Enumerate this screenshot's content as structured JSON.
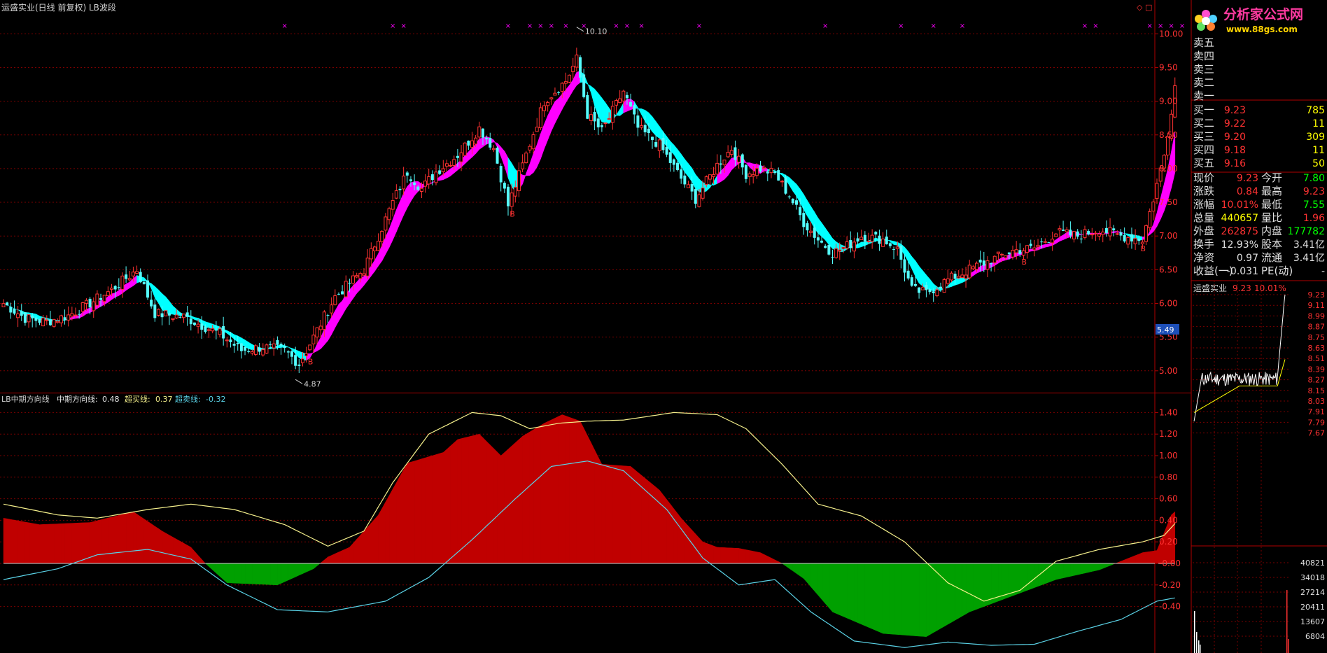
{
  "header": {
    "main_title": "运盛实业(日线 前复权) LB波段",
    "corner_icons": "◇ □",
    "price_tag": "5.49"
  },
  "indicator_header": {
    "name": "LB中期方向线",
    "mid_label": "中期方向线:",
    "mid_value": "0.48",
    "buy_label": "超买线:",
    "buy_value": "0.37",
    "sell_label": "超卖线:",
    "sell_value": "-0.32"
  },
  "logo": {
    "text": "分析家公式网",
    "url": "www.88gs.com"
  },
  "colors": {
    "up": "#ff3232",
    "down": "#54fcfc",
    "band_up": "#ff00ff",
    "band_down": "#00ffff",
    "area_pos": "#c00000",
    "area_neg": "#00a000",
    "yellow_line": "#f5f08c",
    "cyan_line": "#5ad2e6",
    "grid": "#7a0000",
    "text_yellow": "#ffff00",
    "text_green": "#00ff00"
  },
  "order_book": {
    "asks": [
      {
        "label": "卖五",
        "price": "",
        "vol": ""
      },
      {
        "label": "卖四",
        "price": "",
        "vol": ""
      },
      {
        "label": "卖三",
        "price": "",
        "vol": ""
      },
      {
        "label": "卖二",
        "price": "",
        "vol": ""
      },
      {
        "label": "卖一",
        "price": "",
        "vol": ""
      }
    ],
    "bids": [
      {
        "label": "买一",
        "price": "9.23",
        "vol": "785"
      },
      {
        "label": "买二",
        "price": "9.22",
        "vol": "11"
      },
      {
        "label": "买三",
        "price": "9.20",
        "vol": "309"
      },
      {
        "label": "买四",
        "price": "9.18",
        "vol": "11"
      },
      {
        "label": "买五",
        "price": "9.16",
        "vol": "50"
      }
    ]
  },
  "quote": [
    {
      "l1": "现价",
      "v1": "9.23",
      "c1": "r",
      "l2": "今开",
      "v2": "7.80",
      "c2": "g"
    },
    {
      "l1": "涨跌",
      "v1": "0.84",
      "c1": "r",
      "l2": "最高",
      "v2": "9.23",
      "c2": "r"
    },
    {
      "l1": "涨幅",
      "v1": "10.01%",
      "c1": "r",
      "l2": "最低",
      "v2": "7.55",
      "c2": "g"
    },
    {
      "l1": "总量",
      "v1": "440657",
      "c1": "y",
      "l2": "量比",
      "v2": "1.96",
      "c2": "r"
    },
    {
      "l1": "外盘",
      "v1": "262875",
      "c1": "r",
      "l2": "内盘",
      "v2": "177782",
      "c2": "g"
    },
    {
      "l1": "换手",
      "v1": "12.93%",
      "c1": "w",
      "l2": "股本",
      "v2": "3.41亿",
      "c2": "w"
    },
    {
      "l1": "净资",
      "v1": "0.97",
      "c1": "w",
      "l2": "流通",
      "v2": "3.41亿",
      "c2": "w"
    },
    {
      "l1": "收益(一)",
      "v1": "-0.031",
      "c1": "w",
      "l2": "PE(动)",
      "v2": "-",
      "c2": "w"
    }
  ],
  "mini": {
    "name": "运盛实业",
    "price": "9.23",
    "pct": "10.01%",
    "price_ticks": [
      "9.23",
      "9.11",
      "8.99",
      "8.87",
      "8.75",
      "8.63",
      "8.51",
      "8.39",
      "8.27",
      "8.15",
      "8.03",
      "7.91",
      "7.79",
      "7.67"
    ],
    "vol_ticks": [
      "40821",
      "34018",
      "27214",
      "20411",
      "13607",
      "6804"
    ]
  },
  "chart_data": [
    {
      "type": "candlestick",
      "title": "运盛实业(日线 前复权) LB波段",
      "y_ticks": [
        "10.00",
        "9.50",
        "9.00",
        "8.50",
        "8.00",
        "7.50",
        "7.00",
        "6.50",
        "6.00",
        "5.50",
        "5.00"
      ],
      "ylim": [
        4.75,
        10.25
      ],
      "annotations": [
        {
          "label": "10.10",
          "bar": 159,
          "price": 10.1,
          "kind": "high"
        },
        {
          "label": "4.87",
          "bar": 81,
          "price": 4.87,
          "kind": "low"
        }
      ],
      "buy_marks": [
        84,
        140,
        282,
        315
      ],
      "x_marks": [
        78,
        108,
        111,
        140,
        146,
        149,
        152,
        156,
        161,
        170,
        173,
        177,
        193,
        228,
        249,
        258,
        266,
        300,
        303,
        318,
        321,
        324,
        327
      ],
      "anchors": [
        [
          0,
          6.0
        ],
        [
          6,
          5.78
        ],
        [
          12,
          5.73
        ],
        [
          18,
          5.82
        ],
        [
          24,
          6.0
        ],
        [
          30,
          6.2
        ],
        [
          37,
          6.5
        ],
        [
          42,
          5.85
        ],
        [
          50,
          5.8
        ],
        [
          60,
          5.55
        ],
        [
          66,
          5.3
        ],
        [
          72,
          5.35
        ],
        [
          78,
          5.3
        ],
        [
          82,
          5.1
        ],
        [
          86,
          5.5
        ],
        [
          92,
          6.1
        ],
        [
          100,
          6.5
        ],
        [
          108,
          7.5
        ],
        [
          112,
          7.95
        ],
        [
          116,
          7.7
        ],
        [
          120,
          7.95
        ],
        [
          126,
          8.2
        ],
        [
          132,
          8.6
        ],
        [
          136,
          8.3
        ],
        [
          140,
          7.45
        ],
        [
          144,
          8.05
        ],
        [
          150,
          9.0
        ],
        [
          156,
          9.3
        ],
        [
          159,
          9.62
        ],
        [
          162,
          8.8
        ],
        [
          166,
          8.55
        ],
        [
          172,
          9.15
        ],
        [
          176,
          8.6
        ],
        [
          182,
          8.35
        ],
        [
          188,
          7.85
        ],
        [
          192,
          7.55
        ],
        [
          198,
          8.05
        ],
        [
          202,
          8.3
        ],
        [
          206,
          7.92
        ],
        [
          210,
          8.0
        ],
        [
          214,
          7.92
        ],
        [
          218,
          7.6
        ],
        [
          222,
          7.2
        ],
        [
          226,
          6.95
        ],
        [
          230,
          6.75
        ],
        [
          234,
          6.85
        ],
        [
          238,
          7.0
        ],
        [
          244,
          6.95
        ],
        [
          248,
          6.8
        ],
        [
          252,
          6.2
        ],
        [
          256,
          6.15
        ],
        [
          262,
          6.35
        ],
        [
          270,
          6.55
        ],
        [
          280,
          6.78
        ],
        [
          286,
          6.82
        ],
        [
          292,
          7.05
        ],
        [
          298,
          7.0
        ],
        [
          304,
          7.1
        ],
        [
          310,
          7.0
        ],
        [
          316,
          6.95
        ],
        [
          319,
          7.55
        ],
        [
          322,
          8.2
        ],
        [
          325,
          9.23
        ]
      ],
      "band_colors": [
        [
          0,
          "c"
        ],
        [
          18,
          "m"
        ],
        [
          37,
          "c"
        ],
        [
          84,
          "m"
        ],
        [
          140,
          "c"
        ],
        [
          143,
          "m"
        ],
        [
          160,
          "c"
        ],
        [
          172,
          "m"
        ],
        [
          175,
          "c"
        ],
        [
          198,
          "m"
        ],
        [
          212,
          "c"
        ],
        [
          252,
          "c"
        ],
        [
          268,
          "m"
        ],
        [
          311,
          "c"
        ],
        [
          316,
          "m"
        ]
      ]
    },
    {
      "type": "area",
      "title": "LB中期方向线",
      "y_ticks": [
        "1.40",
        "1.20",
        "1.00",
        "0.80",
        "0.60",
        "0.40",
        "0.20",
        "-0.00",
        "-0.20",
        "-0.40"
      ],
      "ylim": [
        -0.8,
        1.55
      ],
      "series": [
        {
          "name": "中期方向线",
          "style": "area",
          "anchors": [
            [
              0,
              0.42
            ],
            [
              10,
              0.36
            ],
            [
              24,
              0.38
            ],
            [
              36,
              0.48
            ],
            [
              44,
              0.3
            ],
            [
              52,
              0.15
            ],
            [
              56,
              0.0
            ],
            [
              62,
              -0.18
            ],
            [
              76,
              -0.2
            ],
            [
              86,
              -0.05
            ],
            [
              90,
              0.06
            ],
            [
              96,
              0.15
            ],
            [
              104,
              0.45
            ],
            [
              112,
              0.93
            ],
            [
              122,
              1.03
            ],
            [
              126,
              1.15
            ],
            [
              132,
              1.2
            ],
            [
              138,
              1.0
            ],
            [
              144,
              1.18
            ],
            [
              150,
              1.3
            ],
            [
              155,
              1.38
            ],
            [
              160,
              1.32
            ],
            [
              166,
              0.92
            ],
            [
              174,
              0.9
            ],
            [
              182,
              0.68
            ],
            [
              188,
              0.42
            ],
            [
              194,
              0.2
            ],
            [
              198,
              0.15
            ],
            [
              204,
              0.14
            ],
            [
              210,
              0.1
            ],
            [
              216,
              0.0
            ],
            [
              222,
              -0.14
            ],
            [
              230,
              -0.45
            ],
            [
              244,
              -0.65
            ],
            [
              256,
              -0.68
            ],
            [
              268,
              -0.45
            ],
            [
              280,
              -0.3
            ],
            [
              292,
              -0.15
            ],
            [
              304,
              -0.06
            ],
            [
              310,
              0.02
            ],
            [
              316,
              0.1
            ],
            [
              320,
              0.12
            ],
            [
              324,
              0.45
            ],
            [
              325,
              0.48
            ]
          ]
        },
        {
          "name": "超买线",
          "style": "line",
          "anchors": [
            [
              0,
              0.55
            ],
            [
              15,
              0.45
            ],
            [
              26,
              0.42
            ],
            [
              40,
              0.5
            ],
            [
              52,
              0.55
            ],
            [
              64,
              0.5
            ],
            [
              78,
              0.36
            ],
            [
              90,
              0.16
            ],
            [
              100,
              0.3
            ],
            [
              108,
              0.75
            ],
            [
              118,
              1.2
            ],
            [
              130,
              1.4
            ],
            [
              138,
              1.37
            ],
            [
              146,
              1.25
            ],
            [
              154,
              1.3
            ],
            [
              162,
              1.32
            ],
            [
              172,
              1.33
            ],
            [
              186,
              1.4
            ],
            [
              198,
              1.38
            ],
            [
              206,
              1.25
            ],
            [
              216,
              0.92
            ],
            [
              226,
              0.55
            ],
            [
              238,
              0.44
            ],
            [
              250,
              0.2
            ],
            [
              262,
              -0.18
            ],
            [
              272,
              -0.35
            ],
            [
              282,
              -0.25
            ],
            [
              292,
              0.02
            ],
            [
              304,
              0.13
            ],
            [
              316,
              0.2
            ],
            [
              322,
              0.26
            ],
            [
              325,
              0.37
            ]
          ]
        },
        {
          "name": "超卖线",
          "style": "line",
          "anchors": [
            [
              0,
              -0.15
            ],
            [
              15,
              -0.05
            ],
            [
              26,
              0.08
            ],
            [
              40,
              0.13
            ],
            [
              52,
              0.04
            ],
            [
              62,
              -0.2
            ],
            [
              76,
              -0.43
            ],
            [
              90,
              -0.45
            ],
            [
              106,
              -0.35
            ],
            [
              118,
              -0.13
            ],
            [
              130,
              0.22
            ],
            [
              142,
              0.6
            ],
            [
              152,
              0.9
            ],
            [
              162,
              0.95
            ],
            [
              172,
              0.86
            ],
            [
              184,
              0.5
            ],
            [
              194,
              0.05
            ],
            [
              204,
              -0.2
            ],
            [
              214,
              -0.15
            ],
            [
              224,
              -0.45
            ],
            [
              236,
              -0.72
            ],
            [
              250,
              -0.78
            ],
            [
              262,
              -0.73
            ],
            [
              274,
              -0.76
            ],
            [
              286,
              -0.75
            ],
            [
              298,
              -0.63
            ],
            [
              310,
              -0.52
            ],
            [
              320,
              -0.35
            ],
            [
              325,
              -0.32
            ]
          ]
        }
      ]
    }
  ]
}
